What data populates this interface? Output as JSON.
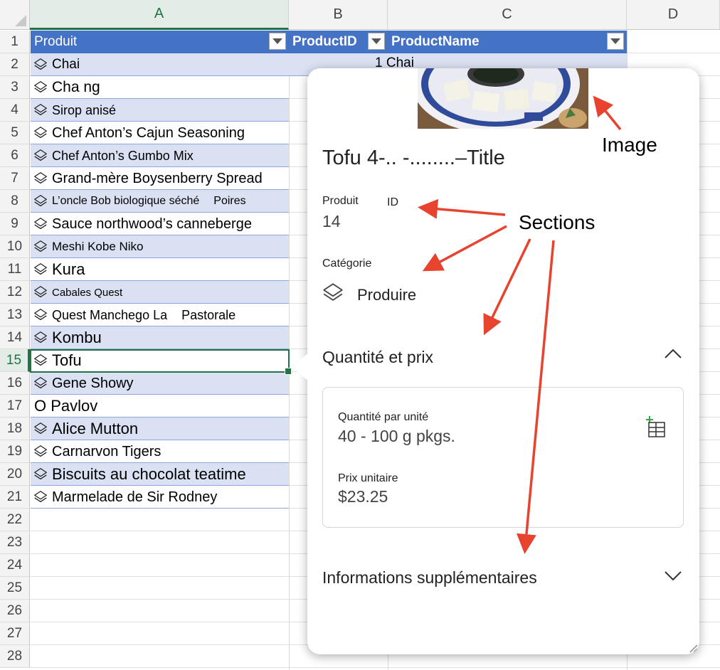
{
  "columns": [
    "A",
    "B",
    "C",
    "D"
  ],
  "rows": [
    "1",
    "2",
    "3",
    "4",
    "5",
    "6",
    "7",
    "8",
    "9",
    "10",
    "11",
    "12",
    "13",
    "14",
    "15",
    "16",
    "17",
    "18",
    "19",
    "20",
    "21",
    "22",
    "23",
    "24",
    "25",
    "26",
    "27",
    "28"
  ],
  "table_headers": {
    "produit": "Produit",
    "product_id": "ProductID",
    "product_name": "ProductName"
  },
  "first_row_c": "1 Chai",
  "products": [
    {
      "name": "Chai",
      "size": 19,
      "icon": true
    },
    {
      "name": "Cha ng",
      "size": 21,
      "icon": true
    },
    {
      "name": "Sirop anisé",
      "size": 18,
      "icon": true
    },
    {
      "name": "Chef Anton’s Cajun Seasoning",
      "size": 20,
      "icon": true
    },
    {
      "name": "Chef Anton’s Gumbo Mix",
      "size": 18,
      "icon": true
    },
    {
      "name": "Grand-mère Boysenberry Spread",
      "size": 20,
      "icon": true
    },
    {
      "name": "L’oncle Bob biologique séché",
      "size": 16,
      "icon": true,
      "extra": "Poires"
    },
    {
      "name": "Sauce northwood’s canneberge",
      "size": 20,
      "icon": true
    },
    {
      "name": "Meshi Kobe Niko",
      "size": 17,
      "icon": true
    },
    {
      "name": "Kura",
      "size": 22,
      "icon": true
    },
    {
      "name": "Cabales Quest",
      "size": 15,
      "icon": true
    },
    {
      "name": "Quest Manchego La",
      "size": 18,
      "icon": true,
      "extra": "Pastorale"
    },
    {
      "name": "Kombu",
      "size": 22,
      "icon": true
    },
    {
      "name": "Tofu",
      "size": 22,
      "icon": true
    },
    {
      "name": "Gene Showy",
      "size": 20,
      "icon": true
    },
    {
      "name": "O Pavlov",
      "size": 22,
      "icon": false
    },
    {
      "name": "Alice Mutton",
      "size": 22,
      "icon": true
    },
    {
      "name": "Carnarvon Tigers",
      "size": 20,
      "icon": true
    },
    {
      "name": "Biscuits au chocolat teatime",
      "size": 22,
      "icon": true
    },
    {
      "name": "Marmelade de Sir Rodney",
      "size": 20,
      "icon": true
    }
  ],
  "card": {
    "title": "Tofu 4-.. -........–Title",
    "product_label": "Produit",
    "id_label": "ID",
    "id_value": "14",
    "category_label": "Catégorie",
    "category_value": "Produire",
    "section_qp": "Quantité et prix",
    "qty_label": "Quantité par unité",
    "qty_value": "40 - 100 g pkgs.",
    "price_label": "Prix unitaire",
    "price_value": "$23.25",
    "section_more": "Informations supplémentaires"
  },
  "annotations": {
    "image": "Image",
    "sections": "Sections"
  },
  "colors": {
    "header_blue": "#4472c4",
    "band_light": "#d9e1f2",
    "excel_green": "#217346",
    "arrow_red": "#e8432e"
  },
  "icons": {
    "row_icon": "layers-icon",
    "category_icon": "layers-icon",
    "add_icon": "add-to-grid-icon"
  }
}
